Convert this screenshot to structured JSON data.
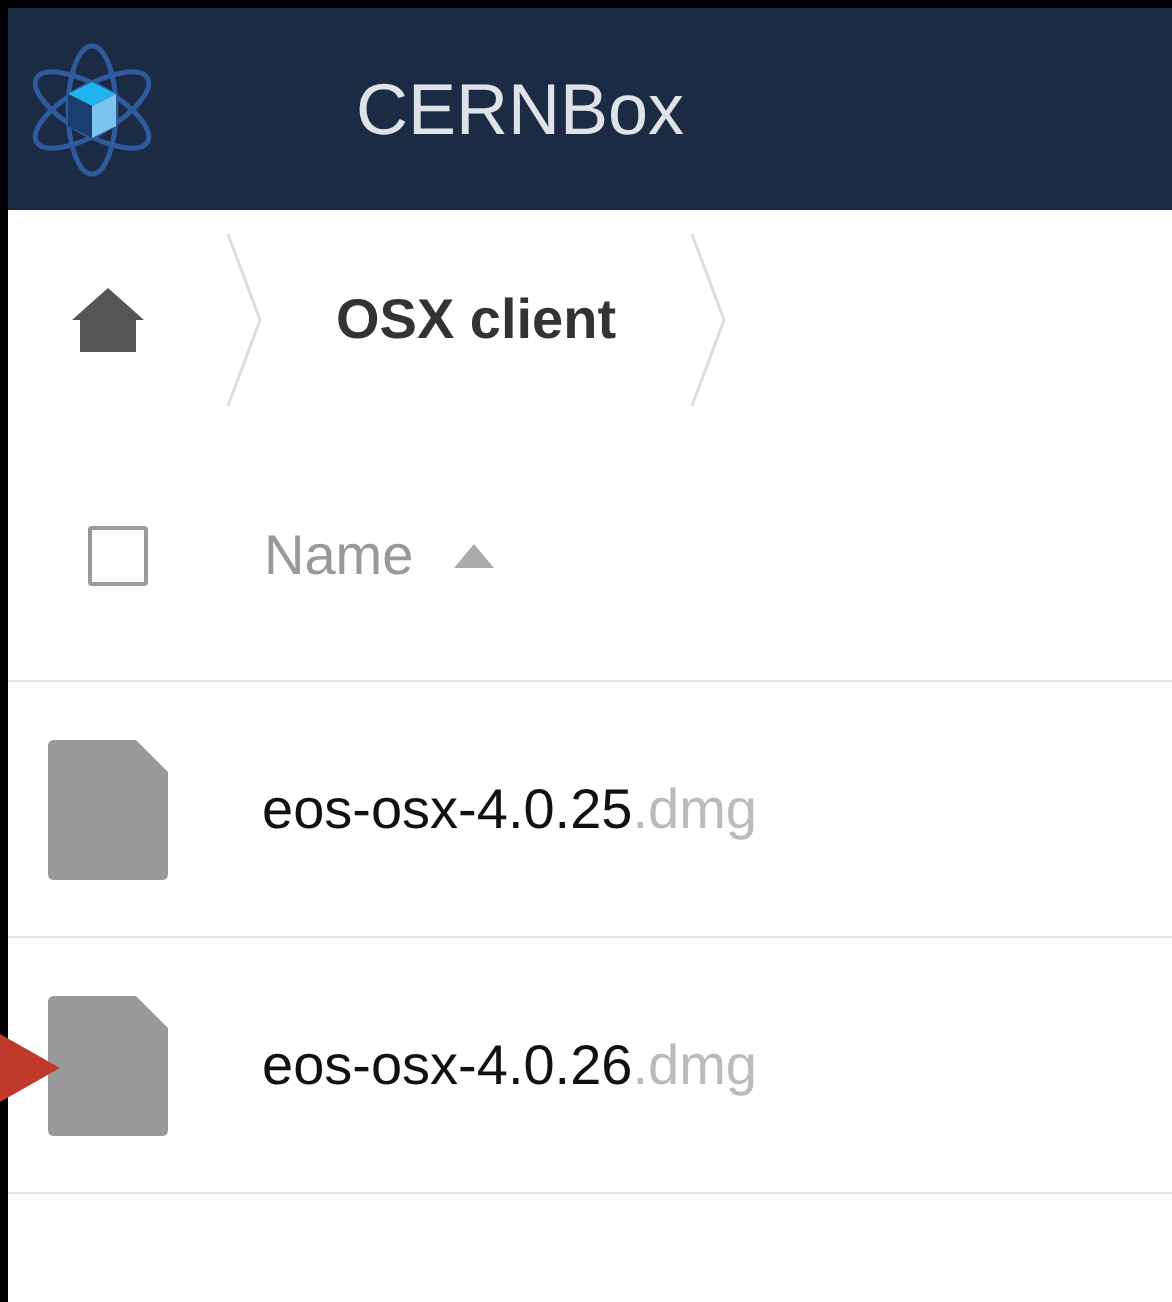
{
  "header": {
    "title": "CERNBox"
  },
  "breadcrumb": [
    {
      "label": "OSX client"
    }
  ],
  "table": {
    "select_all": {
      "checked": false
    },
    "columns": [
      {
        "label": "Name",
        "sort_ascending": true
      }
    ],
    "rows": [
      {
        "name": "eos-osx-4.0.25",
        "extension": ".dmg",
        "pointed": false
      },
      {
        "name": "eos-osx-4.0.26",
        "extension": ".dmg",
        "pointed": true
      }
    ]
  }
}
